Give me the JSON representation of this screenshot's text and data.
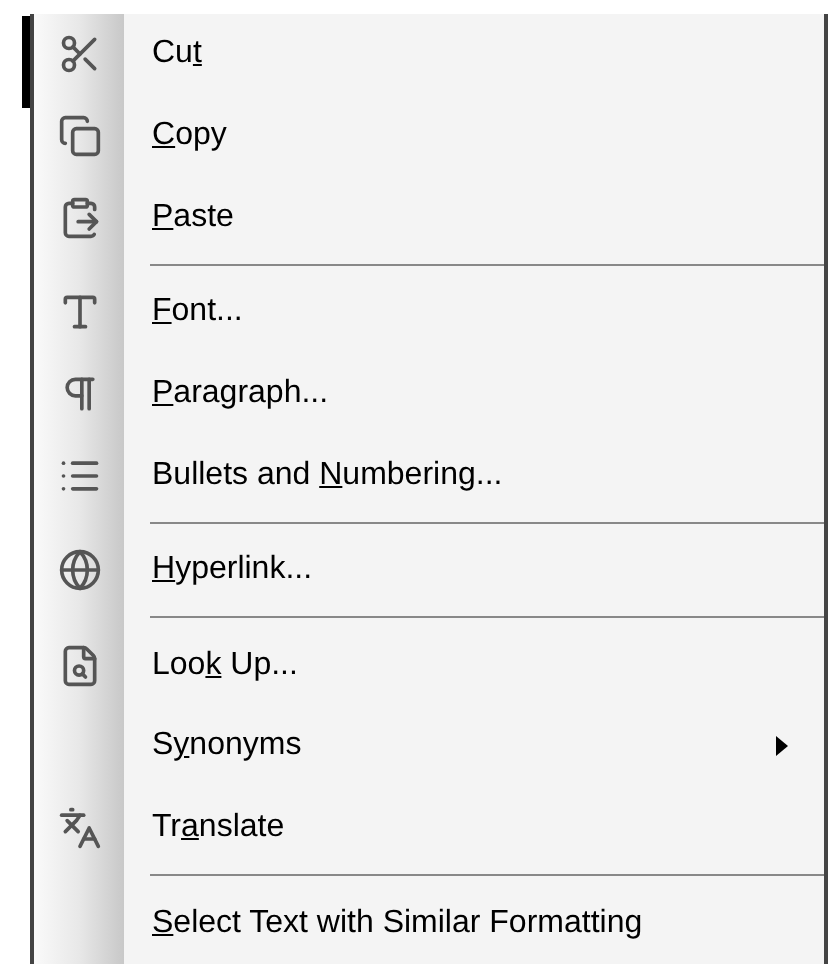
{
  "menu": {
    "items": [
      {
        "kind": "item",
        "label": {
          "before": "Cu",
          "key": "t"
        }
      },
      {
        "kind": "item",
        "label": {
          "key": "C",
          "after": "opy"
        }
      },
      {
        "kind": "item",
        "label": {
          "key": "P",
          "after": "aste"
        }
      },
      {
        "kind": "separator"
      },
      {
        "kind": "item",
        "label": {
          "key": "F",
          "after": "ont..."
        }
      },
      {
        "kind": "item",
        "label": {
          "key": "P",
          "after": "aragraph..."
        }
      },
      {
        "kind": "item",
        "label": {
          "before": "Bullets and ",
          "key": "N",
          "after": "umbering..."
        }
      },
      {
        "kind": "separator"
      },
      {
        "kind": "item",
        "label": {
          "key": "H",
          "after": "yperlink..."
        }
      },
      {
        "kind": "separator"
      },
      {
        "kind": "item",
        "label": {
          "before": "Loo",
          "key": "k",
          "after": " Up..."
        }
      },
      {
        "kind": "submenu",
        "label": {
          "before": "S",
          "key": "y",
          "after": "nonyms"
        }
      },
      {
        "kind": "item",
        "label": {
          "before": "Tr",
          "key": "a",
          "after": "nslate"
        }
      },
      {
        "kind": "separator"
      },
      {
        "kind": "item",
        "label": {
          "key": "S",
          "after": "elect Text with Similar Formatting"
        }
      }
    ]
  }
}
